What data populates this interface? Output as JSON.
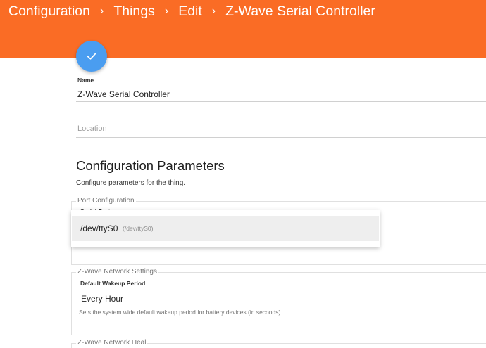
{
  "header": {
    "breadcrumb": [
      {
        "label": "Configuration"
      },
      {
        "label": "Things"
      },
      {
        "label": "Edit"
      },
      {
        "label": "Z-Wave Serial Controller"
      }
    ],
    "separator": "›",
    "color": "#fa6c25"
  },
  "save_fab": {
    "icon": "check-icon",
    "color": "#4a9df0"
  },
  "name_field": {
    "label": "Name",
    "value": "Z-Wave Serial Controller"
  },
  "location_field": {
    "placeholder": "Location",
    "value": ""
  },
  "config": {
    "title": "Configuration Parameters",
    "description": "Configure parameters for the thing."
  },
  "port_group": {
    "legend": "Port Configuration",
    "serial_port_label": "Serial Port",
    "dropdown": {
      "options": [
        {
          "label": "/dev/ttyS0",
          "value": "(/dev/ttyS0)"
        }
      ]
    }
  },
  "network_group": {
    "legend": "Z-Wave Network Settings",
    "wakeup_label": "Default Wakeup Period",
    "wakeup_value": "Every Hour",
    "wakeup_description": "Sets the system wide default wakeup period for battery devices (in seconds)."
  },
  "heal_group": {
    "legend": "Z-Wave Network Heal"
  }
}
